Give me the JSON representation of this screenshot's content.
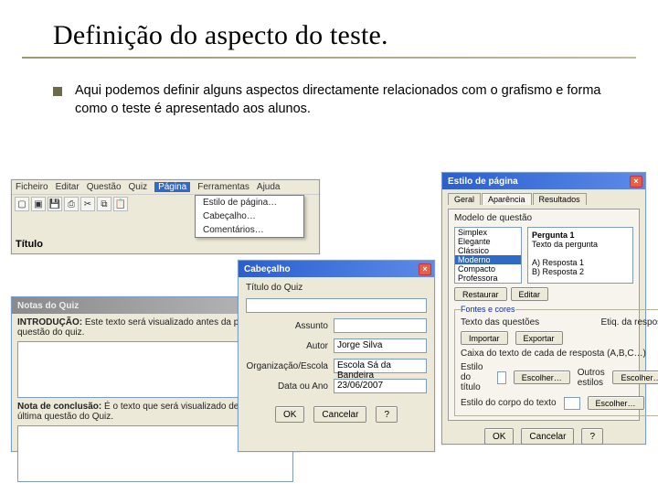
{
  "slide": {
    "title": "Definição do aspecto do teste.",
    "bullet": "Aqui podemos definir alguns aspectos directamente relacionados com o grafismo e forma como o teste é apresentado aos alunos."
  },
  "toolbar_win": {
    "menus": [
      "Ficheiro",
      "Editar",
      "Questão",
      "Quiz",
      "Página",
      "Ferramentas",
      "Ajuda"
    ],
    "selected_menu": "Página",
    "dropdown": [
      "Estilo de página…",
      "Cabeçalho…",
      "Comentários…"
    ],
    "titulo_label": "Título"
  },
  "notas_win": {
    "title": "Notas do Quiz",
    "intro_label": "INTRODUÇÃO:",
    "intro_hint": "Este texto será visualizado antes da primeira questão do quiz.",
    "intro_value": "",
    "conc_label": "Nota de conclusão:",
    "conc_hint": "É o texto que será visualizado depois da última questão do Quiz.",
    "conc_value": ""
  },
  "cabecalho_win": {
    "title": "Cabeçalho",
    "titulo_label": "Título do Quiz",
    "titulo_value": "",
    "assunto_label": "Assunto",
    "assunto_value": "",
    "autor_label": "Autor",
    "autor_value": "Jorge Silva",
    "org_label": "Organização/Escola",
    "org_value": "Escola Sá da Bandeira",
    "data_label": "Data ou Ano",
    "data_value": "23/06/2007",
    "ok": "OK",
    "cancel": "Cancelar",
    "help": "?"
  },
  "estilo_win": {
    "title": "Estilo de página",
    "tabs": [
      "Geral",
      "Aparência",
      "Resultados"
    ],
    "active_tab": "Aparência",
    "modelo_label": "Modelo de questão",
    "styles": [
      "Simplex",
      "Elegante",
      "Clássico",
      "Moderno",
      "Compacto",
      "Professora"
    ],
    "selected_style": "Moderno",
    "preview": {
      "q": "Pergunta 1",
      "q_sub": "Texto da pergunta",
      "a1": "A) Resposta 1",
      "a2": "B) Resposta 2"
    },
    "buttons": {
      "restaurar": "Restaurar",
      "editar": "Editar"
    },
    "fontes_label": "Fontes e cores",
    "col_labels": {
      "texto": "Texto das questões",
      "etiq": "Etiq. da resposta"
    },
    "importar": "Importar",
    "exportar": "Exportar",
    "caixa_label": "Caixa do texto de cada de resposta (A,B,C…)",
    "estilo_titulo": "Estilo do título",
    "escolher": "Escolher…",
    "outros_estilos": "Outros estilos",
    "estilo_corpo": "Estilo do corpo do texto",
    "ok": "OK",
    "cancel": "Cancelar",
    "help": "?"
  }
}
